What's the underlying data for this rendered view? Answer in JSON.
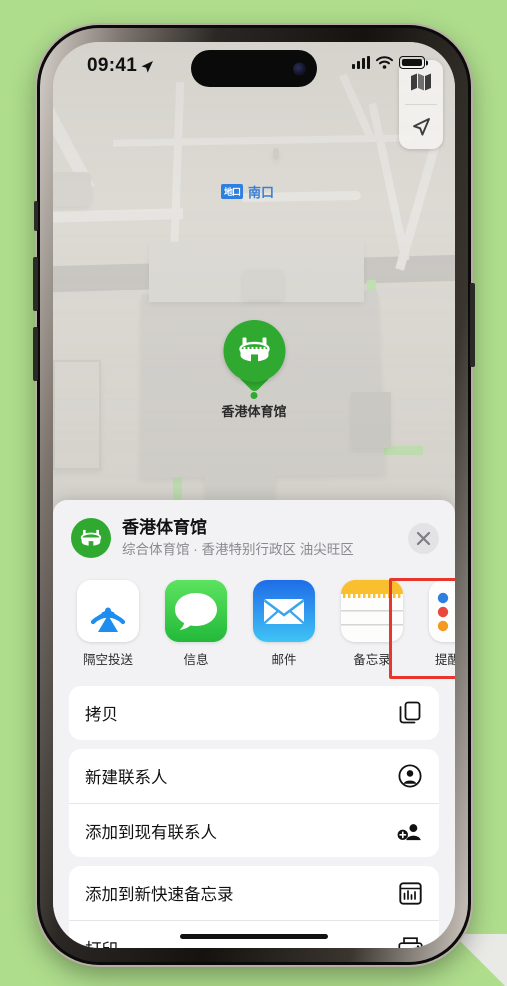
{
  "theme": {
    "background_green": "#aedd8c",
    "accent_green": "#2fa92f",
    "highlight_red": "#e8362c",
    "sheet_bg": "#f2f2f4"
  },
  "status_bar": {
    "time": "09:41",
    "location_icon": "location-arrow-icon",
    "cellular_icon": "cellular-signal-icon",
    "wifi_icon": "wifi-icon",
    "battery_icon": "battery-full-icon"
  },
  "map": {
    "transit_badge": "地口",
    "transit_label": "南口",
    "pin_label": "香港体育馆",
    "pin_icon": "stadium-icon",
    "controls": [
      {
        "name": "map-layers-button",
        "icon": "map-icon"
      },
      {
        "name": "current-location-button",
        "icon": "navigation-arrow-icon"
      }
    ]
  },
  "share_sheet": {
    "place_icon": "stadium-icon",
    "place_title": "香港体育馆",
    "place_subtitle": "综合体育馆 · 香港特别行政区 油尖旺区",
    "close_label": "✕",
    "apps": [
      {
        "name": "airdrop",
        "label": "隔空投送",
        "icon": "airdrop-icon"
      },
      {
        "name": "messages",
        "label": "信息",
        "icon": "messages-icon"
      },
      {
        "name": "mail",
        "label": "邮件",
        "icon": "mail-icon"
      },
      {
        "name": "notes",
        "label": "备忘录",
        "icon": "notes-icon",
        "highlighted": true
      },
      {
        "name": "reminders",
        "label": "提醒事项",
        "icon": "reminders-icon"
      }
    ],
    "action_groups": [
      {
        "items": [
          {
            "name": "copy",
            "label": "拷贝",
            "icon": "copy-icon"
          }
        ]
      },
      {
        "items": [
          {
            "name": "new-contact",
            "label": "新建联系人",
            "icon": "person-circle-icon"
          },
          {
            "name": "add-to-existing-contact",
            "label": "添加到现有联系人",
            "icon": "person-add-icon"
          }
        ]
      },
      {
        "items": [
          {
            "name": "add-to-new-quick-note",
            "label": "添加到新快速备忘录",
            "icon": "quick-note-icon"
          },
          {
            "name": "print",
            "label": "打印",
            "icon": "printer-icon"
          }
        ]
      }
    ]
  }
}
